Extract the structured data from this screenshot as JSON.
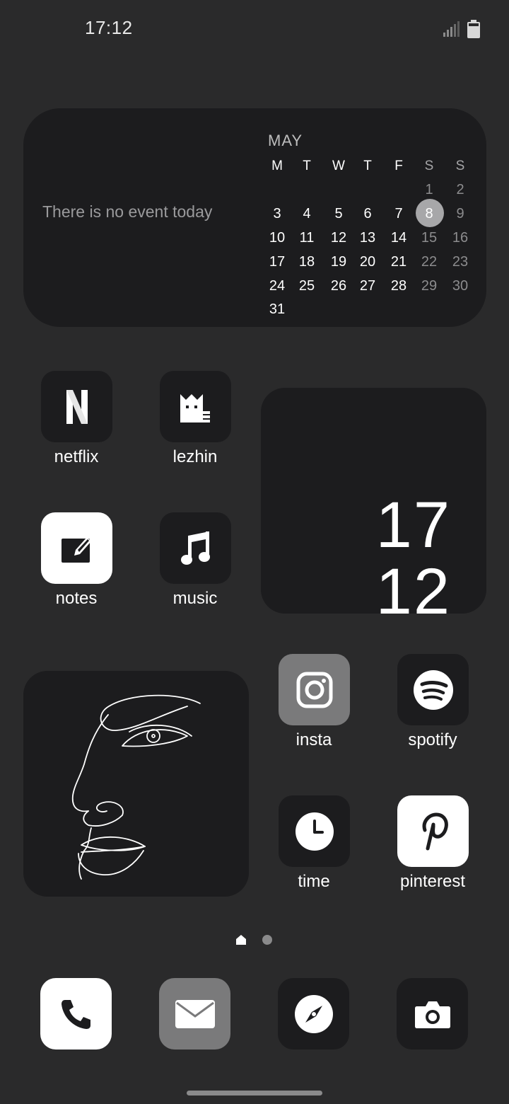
{
  "status_bar": {
    "time": "17:12"
  },
  "calendar_widget": {
    "no_event_text": "There is no event today",
    "month": "MAY",
    "weekdays": [
      "M",
      "T",
      "W",
      "T",
      "F",
      "S",
      "S"
    ],
    "weeks": [
      [
        "",
        "",
        "",
        "",
        "",
        "1",
        "2"
      ],
      [
        "3",
        "4",
        "5",
        "6",
        "7",
        "8",
        "9"
      ],
      [
        "10",
        "11",
        "12",
        "13",
        "14",
        "15",
        "16"
      ],
      [
        "17",
        "18",
        "19",
        "20",
        "21",
        "22",
        "23"
      ],
      [
        "24",
        "25",
        "26",
        "27",
        "28",
        "29",
        "30"
      ],
      [
        "31",
        "",
        "",
        "",
        "",
        "",
        ""
      ]
    ],
    "today": "8"
  },
  "apps": {
    "netflix": {
      "label": "netflix",
      "icon": "netflix-icon"
    },
    "lezhin": {
      "label": "lezhin",
      "icon": "lezhin-icon"
    },
    "notes": {
      "label": "notes",
      "icon": "notes-icon"
    },
    "music": {
      "label": "music",
      "icon": "music-note-icon"
    },
    "insta": {
      "label": "insta",
      "icon": "instagram-icon"
    },
    "spotify": {
      "label": "spotify",
      "icon": "spotify-icon"
    },
    "time": {
      "label": "time",
      "icon": "clock-icon"
    },
    "pinterest": {
      "label": "pinterest",
      "icon": "pinterest-icon"
    }
  },
  "clock_widget": {
    "hour": "17",
    "minute": "12"
  },
  "dock": [
    {
      "name": "phone",
      "icon": "phone-icon"
    },
    {
      "name": "mail",
      "icon": "mail-icon"
    },
    {
      "name": "safari",
      "icon": "compass-icon"
    },
    {
      "name": "camera",
      "icon": "camera-icon"
    }
  ],
  "colors": {
    "background": "#2a2a2b",
    "widget": "#1c1c1e",
    "today_highlight": "#a7a7a9",
    "muted_text": "#9a9a9c"
  }
}
